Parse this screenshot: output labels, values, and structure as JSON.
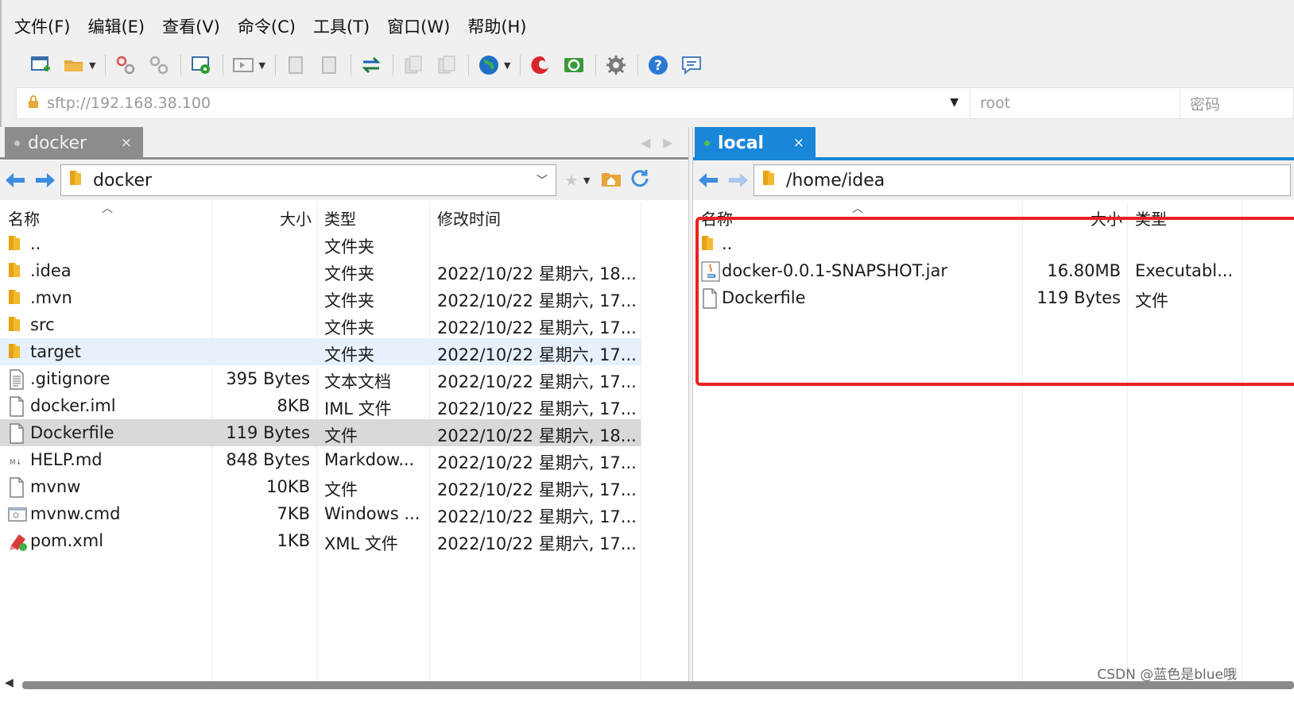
{
  "menu": [
    "文件(F)",
    "编辑(E)",
    "查看(V)",
    "命令(C)",
    "工具(T)",
    "窗口(W)",
    "帮助(H)"
  ],
  "address": {
    "url": "sftp://192.168.38.100",
    "user_placeholder": "root",
    "password_placeholder": "密码"
  },
  "left": {
    "tab_label": "docker",
    "tab_close": "×",
    "path": "docker",
    "headers": {
      "name": "名称",
      "size": "大小",
      "type": "类型",
      "modified": "修改时间"
    },
    "rows": [
      {
        "name": "..",
        "size": "",
        "type": "文件夹",
        "modified": "",
        "icon": "folder-icon"
      },
      {
        "name": ".idea",
        "size": "",
        "type": "文件夹",
        "modified": "2022/10/22 星期六, 18...",
        "icon": "folder-icon"
      },
      {
        "name": ".mvn",
        "size": "",
        "type": "文件夹",
        "modified": "2022/10/22 星期六, 17...",
        "icon": "folder-icon"
      },
      {
        "name": "src",
        "size": "",
        "type": "文件夹",
        "modified": "2022/10/22 星期六, 17...",
        "icon": "folder-icon"
      },
      {
        "name": "target",
        "size": "",
        "type": "文件夹",
        "modified": "2022/10/22 星期六, 17...",
        "icon": "folder-icon"
      },
      {
        "name": ".gitignore",
        "size": "395 Bytes",
        "type": "文本文档",
        "modified": "2022/10/22 星期六, 17...",
        "icon": "text-file-icon"
      },
      {
        "name": "docker.iml",
        "size": "8KB",
        "type": "IML 文件",
        "modified": "2022/10/22 星期六, 17...",
        "icon": "file-icon"
      },
      {
        "name": "Dockerfile",
        "size": "119 Bytes",
        "type": "文件",
        "modified": "2022/10/22 星期六, 18...",
        "icon": "file-icon"
      },
      {
        "name": "HELP.md",
        "size": "848 Bytes",
        "type": "Markdow...",
        "modified": "2022/10/22 星期六, 17...",
        "icon": "markdown-file-icon"
      },
      {
        "name": "mvnw",
        "size": "10KB",
        "type": "文件",
        "modified": "2022/10/22 星期六, 17...",
        "icon": "file-icon"
      },
      {
        "name": "mvnw.cmd",
        "size": "7KB",
        "type": "Windows ...",
        "modified": "2022/10/22 星期六, 17...",
        "icon": "cmd-file-icon"
      },
      {
        "name": "pom.xml",
        "size": "1KB",
        "type": "XML 文件",
        "modified": "2022/10/22 星期六, 17...",
        "icon": "xml-file-icon"
      }
    ]
  },
  "right": {
    "tab_label": "local",
    "tab_close": "×",
    "path": "/home/idea",
    "headers": {
      "name": "名称",
      "size": "大小",
      "type": "类型"
    },
    "rows": [
      {
        "name": "..",
        "size": "",
        "type": "",
        "icon": "folder-icon"
      },
      {
        "name": "docker-0.0.1-SNAPSHOT.jar",
        "size": "16.80MB",
        "type": "Executabl...",
        "icon": "java-jar-icon"
      },
      {
        "name": "Dockerfile",
        "size": "119 Bytes",
        "type": "文件",
        "icon": "file-icon"
      }
    ]
  },
  "watermark": "CSDN @蓝色是blue哦",
  "colors": {
    "active_tab": "#1a86d8",
    "inactive_tab": "#8c8c8c",
    "highlight": "#ee2020"
  }
}
